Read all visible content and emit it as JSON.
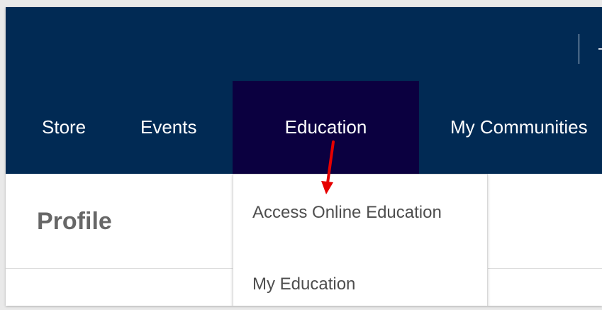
{
  "navigation": {
    "items": [
      {
        "label": "Store"
      },
      {
        "label": "Events"
      },
      {
        "label": "Education"
      },
      {
        "label": "My Communities"
      }
    ]
  },
  "page": {
    "title": "Profile"
  },
  "dropdown": {
    "items": [
      {
        "label": "Access Online Education"
      },
      {
        "label": "My Education"
      }
    ]
  },
  "annotation": {
    "arrow_color": "#e60000"
  },
  "colors": {
    "header_bg": "#012a54",
    "active_nav_bg": "#0b0040",
    "nav_text": "#ffffff",
    "title_text": "#676767",
    "dropdown_text": "#4e4e4e"
  }
}
